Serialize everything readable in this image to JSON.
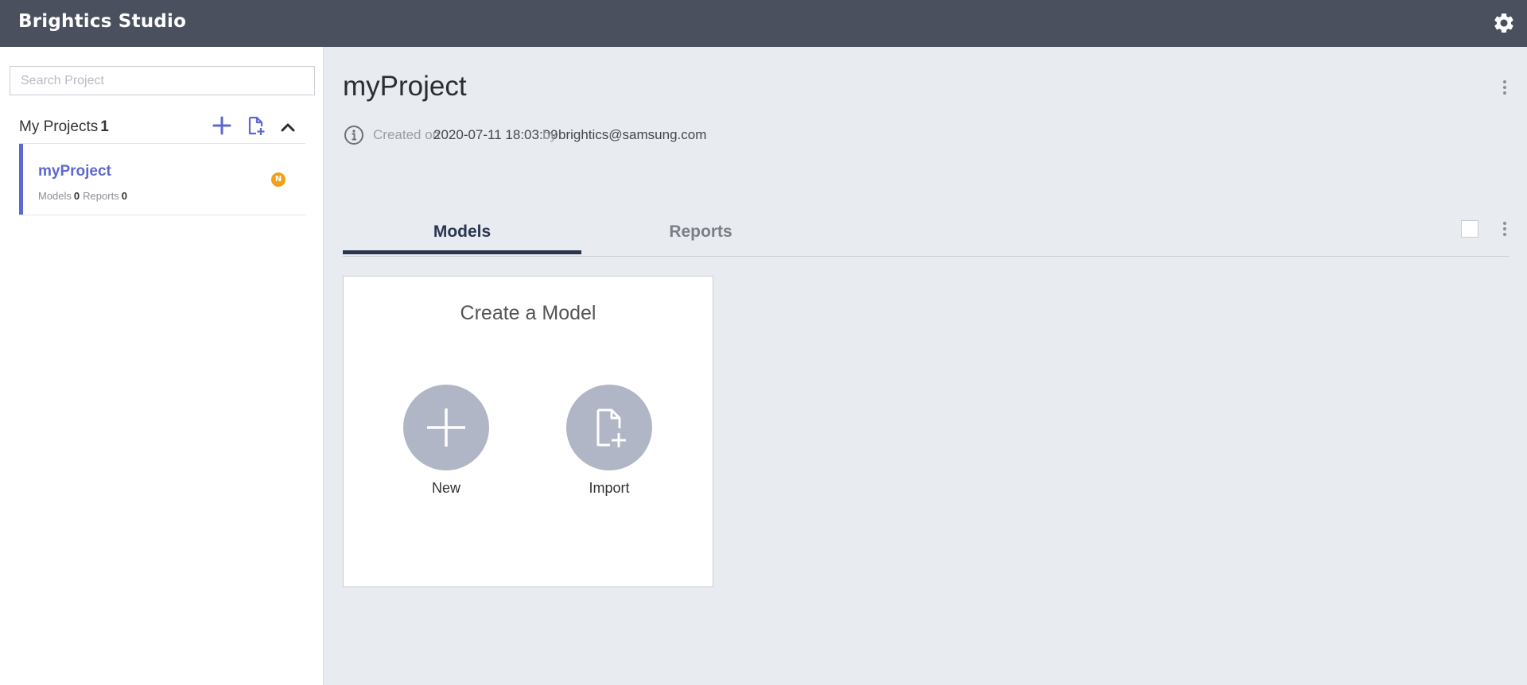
{
  "app": {
    "brand": "Brightics Studio"
  },
  "sidebar": {
    "search_placeholder": "Search Project",
    "projects_label": "My Projects",
    "projects_count": "1",
    "projects": [
      {
        "name": "myProject",
        "models_label": "Models",
        "models_count": "0",
        "reports_label": "Reports",
        "reports_count": "0",
        "badge": "N"
      }
    ]
  },
  "main": {
    "title": "myProject",
    "info": {
      "created_label": "Created on",
      "created_value": "2020-07-11 18:03:09",
      "by_label": "by",
      "author": "brightics@samsung.com"
    },
    "tabs": [
      {
        "label": "Models",
        "active": true
      },
      {
        "label": "Reports",
        "active": false
      }
    ],
    "create_card": {
      "title": "Create a Model",
      "new_label": "New",
      "import_label": "Import"
    }
  },
  "colors": {
    "topbar": "#4a505e",
    "accent": "#5d68d1",
    "tab_active": "#2b3552",
    "badge": "#f2a01c",
    "circle_button": "#b0b6c6"
  }
}
